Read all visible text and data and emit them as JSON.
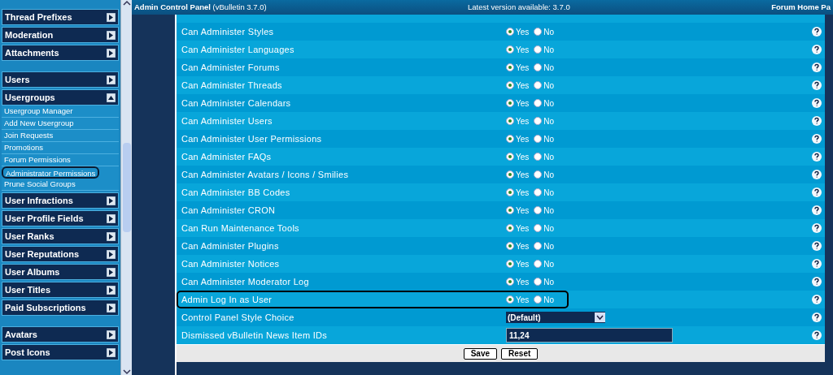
{
  "sidebar": {
    "sections": [
      {
        "items": [
          {
            "label": "Thread Prefixes",
            "expanded": false,
            "highlighted": false
          },
          {
            "label": "Moderation",
            "expanded": false,
            "highlighted": false
          },
          {
            "label": "Attachments",
            "expanded": false,
            "highlighted": false
          }
        ]
      },
      {
        "items": [
          {
            "label": "Users",
            "expanded": false,
            "highlighted": false
          },
          {
            "label": "Usergroups",
            "expanded": true,
            "highlighted": false,
            "children": [
              {
                "label": "Usergroup Manager",
                "highlighted": false
              },
              {
                "label": "Add New Usergroup",
                "highlighted": false
              },
              {
                "label": "Join Requests",
                "highlighted": false
              },
              {
                "label": "Promotions",
                "highlighted": false
              },
              {
                "label": "Forum Permissions",
                "highlighted": false
              },
              {
                "label": "Administrator Permissions",
                "highlighted": true
              },
              {
                "label": "Prune Social Groups",
                "highlighted": false
              }
            ]
          },
          {
            "label": "User Infractions",
            "expanded": false,
            "highlighted": false
          },
          {
            "label": "User Profile Fields",
            "expanded": false,
            "highlighted": false
          },
          {
            "label": "User Ranks",
            "expanded": false,
            "highlighted": false
          },
          {
            "label": "User Reputations",
            "expanded": false,
            "highlighted": false
          },
          {
            "label": "User Albums",
            "expanded": false,
            "highlighted": false
          },
          {
            "label": "User Titles",
            "expanded": false,
            "highlighted": false
          },
          {
            "label": "Paid Subscriptions",
            "expanded": false,
            "highlighted": false
          }
        ]
      },
      {
        "items": [
          {
            "label": "Avatars",
            "expanded": false,
            "highlighted": false
          },
          {
            "label": "Post Icons",
            "expanded": false,
            "highlighted": false
          }
        ]
      }
    ]
  },
  "header": {
    "title": "Admin Control Panel",
    "version": "(vBulletin 3.7.0)",
    "latest": "Latest version available: 3.7.0",
    "link": "Forum Home Pa"
  },
  "rows": [
    {
      "kind": "radio",
      "label": "Can Administer Styles",
      "highlighted": false,
      "options": [
        {
          "label": "Yes",
          "selected": true
        },
        {
          "label": "No",
          "selected": false
        }
      ]
    },
    {
      "kind": "radio",
      "label": "Can Administer Languages",
      "highlighted": false,
      "options": [
        {
          "label": "Yes",
          "selected": true
        },
        {
          "label": "No",
          "selected": false
        }
      ]
    },
    {
      "kind": "radio",
      "label": "Can Administer Forums",
      "highlighted": false,
      "options": [
        {
          "label": "Yes",
          "selected": true
        },
        {
          "label": "No",
          "selected": false
        }
      ]
    },
    {
      "kind": "radio",
      "label": "Can Administer Threads",
      "highlighted": false,
      "options": [
        {
          "label": "Yes",
          "selected": true
        },
        {
          "label": "No",
          "selected": false
        }
      ]
    },
    {
      "kind": "radio",
      "label": "Can Administer Calendars",
      "highlighted": false,
      "options": [
        {
          "label": "Yes",
          "selected": true
        },
        {
          "label": "No",
          "selected": false
        }
      ]
    },
    {
      "kind": "radio",
      "label": "Can Administer Users",
      "highlighted": false,
      "options": [
        {
          "label": "Yes",
          "selected": true
        },
        {
          "label": "No",
          "selected": false
        }
      ]
    },
    {
      "kind": "radio",
      "label": "Can Administer User Permissions",
      "highlighted": false,
      "options": [
        {
          "label": "Yes",
          "selected": true
        },
        {
          "label": "No",
          "selected": false
        }
      ]
    },
    {
      "kind": "radio",
      "label": "Can Administer FAQs",
      "highlighted": false,
      "options": [
        {
          "label": "Yes",
          "selected": true
        },
        {
          "label": "No",
          "selected": false
        }
      ]
    },
    {
      "kind": "radio",
      "label": "Can Administer Avatars / Icons / Smilies",
      "highlighted": false,
      "options": [
        {
          "label": "Yes",
          "selected": true
        },
        {
          "label": "No",
          "selected": false
        }
      ]
    },
    {
      "kind": "radio",
      "label": "Can Administer BB Codes",
      "highlighted": false,
      "options": [
        {
          "label": "Yes",
          "selected": true
        },
        {
          "label": "No",
          "selected": false
        }
      ]
    },
    {
      "kind": "radio",
      "label": "Can Administer CRON",
      "highlighted": false,
      "options": [
        {
          "label": "Yes",
          "selected": true
        },
        {
          "label": "No",
          "selected": false
        }
      ]
    },
    {
      "kind": "radio",
      "label": "Can Run Maintenance Tools",
      "highlighted": false,
      "options": [
        {
          "label": "Yes",
          "selected": true
        },
        {
          "label": "No",
          "selected": false
        }
      ]
    },
    {
      "kind": "radio",
      "label": "Can Administer Plugins",
      "highlighted": false,
      "options": [
        {
          "label": "Yes",
          "selected": true
        },
        {
          "label": "No",
          "selected": false
        }
      ]
    },
    {
      "kind": "radio",
      "label": "Can Administer Notices",
      "highlighted": false,
      "options": [
        {
          "label": "Yes",
          "selected": true
        },
        {
          "label": "No",
          "selected": false
        }
      ]
    },
    {
      "kind": "radio",
      "label": "Can Administer Moderator Log",
      "highlighted": false,
      "options": [
        {
          "label": "Yes",
          "selected": true
        },
        {
          "label": "No",
          "selected": false
        }
      ]
    },
    {
      "kind": "radio",
      "label": "Admin Log In as User",
      "highlighted": true,
      "options": [
        {
          "label": "Yes",
          "selected": true
        },
        {
          "label": "No",
          "selected": false
        }
      ]
    },
    {
      "kind": "select",
      "label": "Control Panel Style Choice",
      "highlighted": false,
      "value": "(Default)"
    },
    {
      "kind": "text",
      "label": "Dismissed vBulletin News Item IDs",
      "highlighted": false,
      "value": "11,24"
    }
  ],
  "buttons": [
    "Save",
    "Reset"
  ]
}
